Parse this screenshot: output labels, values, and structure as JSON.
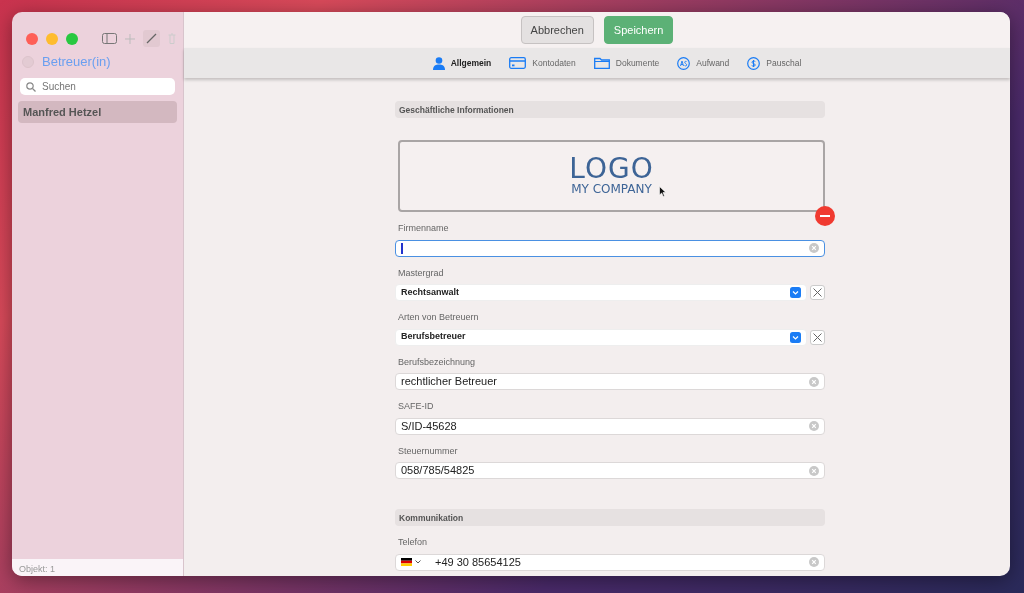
{
  "sidebar": {
    "title": "Betreuer(in)",
    "search": {
      "placeholder": "Suchen"
    },
    "items": [
      {
        "label": "Manfred Hetzel",
        "selected": true
      }
    ],
    "footer": "Objekt: 1"
  },
  "toolbar": {
    "buttons": [
      {
        "label": "Abbrechen",
        "kind": "secondary"
      },
      {
        "label": "Speichern",
        "kind": "primary"
      }
    ]
  },
  "tabs": [
    {
      "label": "Allgemein",
      "selected": true
    },
    {
      "label": "Kontodaten",
      "selected": false
    },
    {
      "label": "Dokumente",
      "selected": false
    },
    {
      "label": "Aufwand",
      "selected": false
    },
    {
      "label": "Pauschal",
      "selected": false
    }
  ],
  "sections": [
    {
      "title": "Geschäftliche Informationen",
      "logo": {
        "line_1": "LOGO",
        "line_2": "MY COMPANY"
      },
      "fields": [
        {
          "label": "Firmenname",
          "kind": "text",
          "focused": true
        },
        {
          "label": "Mastergrad",
          "kind": "select",
          "value": "Rechtsanwalt"
        },
        {
          "label": "Arten von Betreuern",
          "kind": "select",
          "value": "Berufsbetreuer"
        },
        {
          "label": "Berufsbezeichnung",
          "kind": "text",
          "value": "rechtlicher Betreuer",
          "focused": false
        },
        {
          "label": "SAFE-ID",
          "kind": "text",
          "value": "S/ID-45628",
          "focused": false
        },
        {
          "label": "Steuernummer",
          "kind": "text",
          "value": "058/785/54825",
          "focused": false
        }
      ]
    },
    {
      "title": "Kommunikation",
      "fields": [
        {
          "label": "Telefon",
          "kind": "phone",
          "value": "+49 30 85654125"
        }
      ]
    }
  ]
}
